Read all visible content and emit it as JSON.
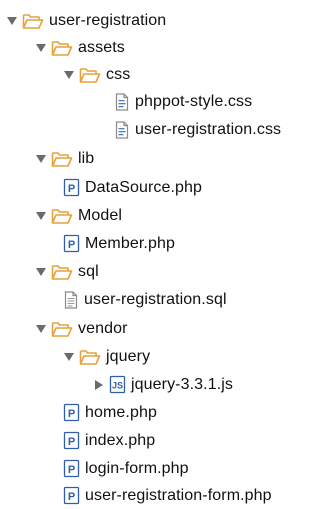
{
  "tree": {
    "root": {
      "label": "user-registration",
      "expanded": true
    },
    "assets": {
      "label": "assets",
      "expanded": true
    },
    "css": {
      "label": "css",
      "expanded": true
    },
    "phppot_style": {
      "label": "phppot-style.css"
    },
    "user_registration_css": {
      "label": "user-registration.css"
    },
    "lib": {
      "label": "lib",
      "expanded": true
    },
    "datasource": {
      "label": "DataSource.php"
    },
    "model": {
      "label": "Model",
      "expanded": true
    },
    "member": {
      "label": "Member.php"
    },
    "sql": {
      "label": "sql",
      "expanded": true
    },
    "user_registration_sql": {
      "label": "user-registration.sql"
    },
    "vendor": {
      "label": "vendor",
      "expanded": true
    },
    "jquery_folder": {
      "label": "jquery",
      "expanded": true
    },
    "jquery_js": {
      "label": "jquery-3.3.1.js",
      "expanded": false
    },
    "home": {
      "label": "home.php"
    },
    "index": {
      "label": "index.php"
    },
    "login_form": {
      "label": "login-form.php"
    },
    "user_registration_form": {
      "label": "user-registration-form.php"
    }
  },
  "colors": {
    "folder": "#e6a23c",
    "twisty": "#6b6b6b",
    "php_icon": "#2f5fa8",
    "css_icon": "#8a8a8a",
    "js_icon": "#2f5fa8"
  },
  "icons": {
    "twisty_open": "chevron-down-icon",
    "twisty_closed": "chevron-right-icon",
    "folder": "folder-open-icon",
    "php": "php-file-icon",
    "css": "css-file-icon",
    "sql": "sql-file-icon",
    "js": "js-file-icon"
  }
}
